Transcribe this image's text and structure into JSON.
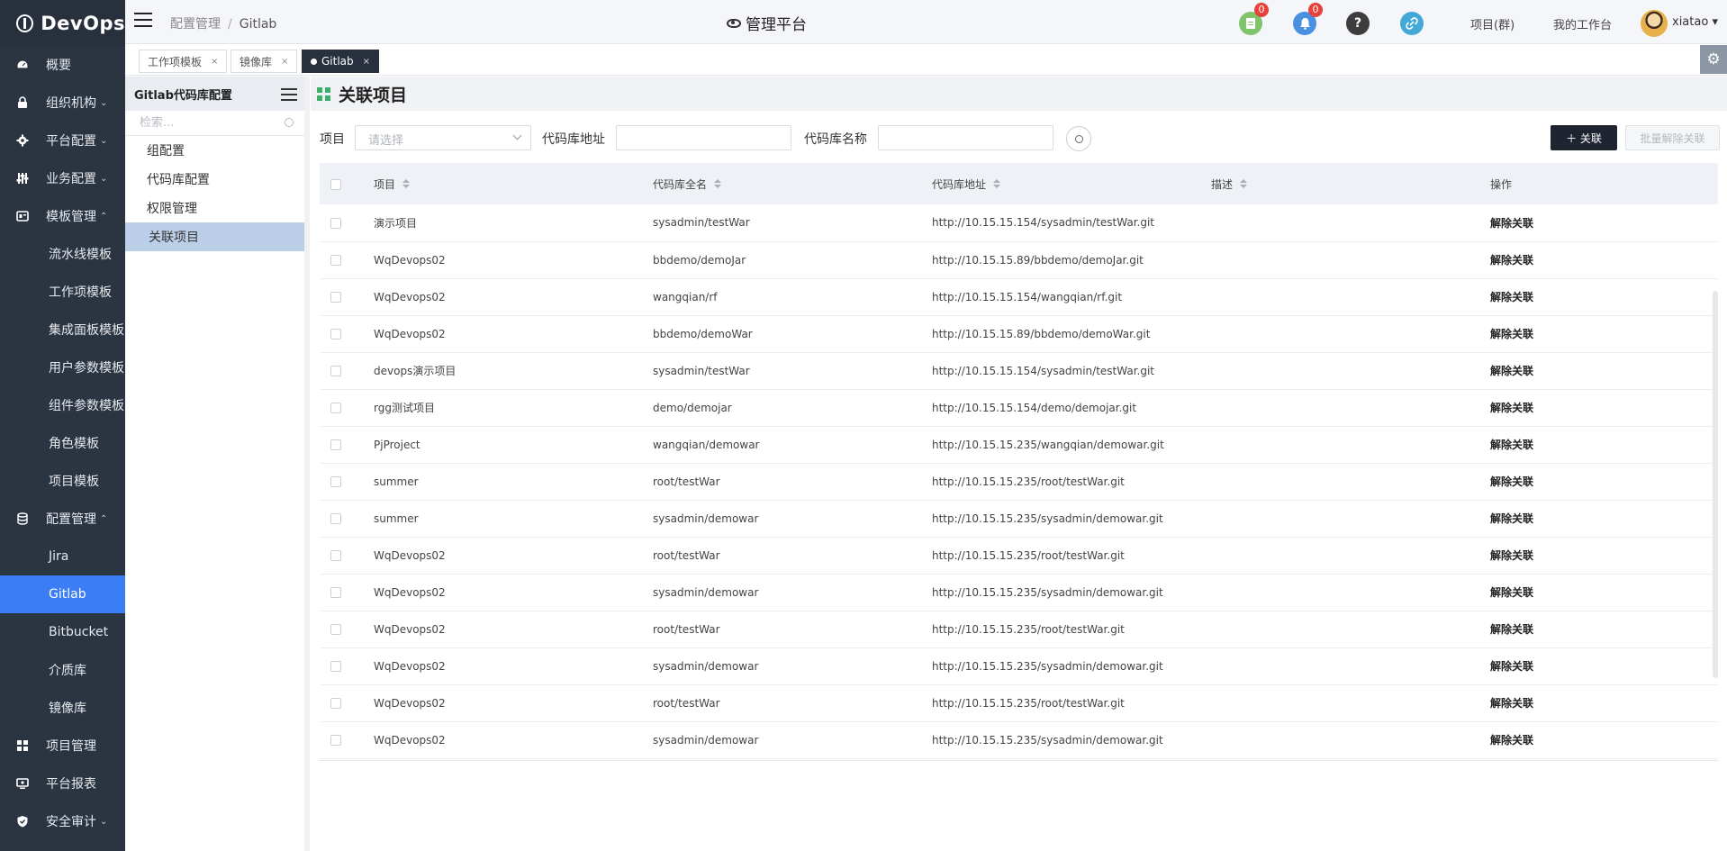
{
  "app": {
    "name": "DevOps"
  },
  "sidebar": {
    "items": [
      {
        "label": "概要",
        "icon": "dashboard-icon",
        "chevron": ""
      },
      {
        "label": "组织机构",
        "icon": "lock-icon",
        "chevron": "⌄"
      },
      {
        "label": "平台配置",
        "icon": "gear-icon",
        "chevron": "⌄"
      },
      {
        "label": "业务配置",
        "icon": "sliders-icon",
        "chevron": "⌄"
      },
      {
        "label": "模板管理",
        "icon": "template-icon",
        "chevron": "⌃"
      }
    ],
    "template_sub": [
      "流水线模板",
      "工作项模板",
      "集成面板模板",
      "用户参数模板",
      "组件参数模板",
      "角色模板",
      "项目模板"
    ],
    "config_item": {
      "label": "配置管理",
      "icon": "database-icon",
      "chevron": "⌃"
    },
    "config_sub": [
      "Jira",
      "Gitlab",
      "Bitbucket",
      "介质库",
      "镜像库"
    ],
    "bottom_items": [
      {
        "label": "项目管理",
        "icon": "grid-icon",
        "chevron": ""
      },
      {
        "label": "平台报表",
        "icon": "report-icon",
        "chevron": ""
      },
      {
        "label": "安全审计",
        "icon": "shield-icon",
        "chevron": "⌄"
      }
    ]
  },
  "header": {
    "breadcrumb": [
      "配置管理",
      "Gitlab"
    ],
    "breadcrumb_sep": "/",
    "platform_title": "管理平台",
    "badge_doc": "0",
    "badge_bell": "0",
    "help_glyph": "?",
    "projects_link": "项目(群)",
    "workbench_link": "我的工作台",
    "username": "xiatao",
    "user_caret": "▾",
    "colors": {
      "doc": "#7fc36b",
      "bell": "#4a90e2",
      "help": "#3d3d3d",
      "link": "#43a8d6"
    }
  },
  "tabs": [
    {
      "label": "工作项模板",
      "close": "×"
    },
    {
      "label": "镜像库",
      "close": "×"
    },
    {
      "label": "Gitlab",
      "close": "×"
    }
  ],
  "left_panel": {
    "title": "Gitlab代码库配置",
    "search_placeholder": "检索...",
    "items": [
      "组配置",
      "代码库配置",
      "权限管理",
      "关联项目"
    ]
  },
  "main": {
    "title": "关联项目",
    "filters": {
      "project_label": "项目",
      "project_placeholder": "请选择",
      "repo_addr_label": "代码库地址",
      "repo_name_label": "代码库名称"
    },
    "link_button": "＋ 关联",
    "batch_unlink_button": "批量解除关联"
  },
  "table": {
    "columns": [
      "项目",
      "代码库全名",
      "代码库地址",
      "描述",
      "操作"
    ],
    "rows": [
      [
        "演示项目",
        "sysadmin/testWar",
        "http://10.15.15.154/sysadmin/testWar.git",
        "",
        "解除关联"
      ],
      [
        "WqDevops02",
        "bbdemo/demoJar",
        "http://10.15.15.89/bbdemo/demoJar.git",
        "",
        "解除关联"
      ],
      [
        "WqDevops02",
        "wangqian/rf",
        "http://10.15.15.154/wangqian/rf.git",
        "",
        "解除关联"
      ],
      [
        "WqDevops02",
        "bbdemo/demoWar",
        "http://10.15.15.89/bbdemo/demoWar.git",
        "",
        "解除关联"
      ],
      [
        "devops演示项目",
        "sysadmin/testWar",
        "http://10.15.15.154/sysadmin/testWar.git",
        "",
        "解除关联"
      ],
      [
        "rgg测试项目",
        "demo/demojar",
        "http://10.15.15.154/demo/demojar.git",
        "",
        "解除关联"
      ],
      [
        "PjProject",
        "wangqian/demowar",
        "http://10.15.15.235/wangqian/demowar.git",
        "",
        "解除关联"
      ],
      [
        "summer",
        "root/testWar",
        "http://10.15.15.235/root/testWar.git",
        "",
        "解除关联"
      ],
      [
        "summer",
        "sysadmin/demowar",
        "http://10.15.15.235/sysadmin/demowar.git",
        "",
        "解除关联"
      ],
      [
        "WqDevops02",
        "root/testWar",
        "http://10.15.15.235/root/testWar.git",
        "",
        "解除关联"
      ],
      [
        "WqDevops02",
        "sysadmin/demowar",
        "http://10.15.15.235/sysadmin/demowar.git",
        "",
        "解除关联"
      ],
      [
        "WqDevops02",
        "root/testWar",
        "http://10.15.15.235/root/testWar.git",
        "",
        "解除关联"
      ],
      [
        "WqDevops02",
        "sysadmin/demowar",
        "http://10.15.15.235/sysadmin/demowar.git",
        "",
        "解除关联"
      ],
      [
        "WqDevops02",
        "root/testWar",
        "http://10.15.15.235/root/testWar.git",
        "",
        "解除关联"
      ],
      [
        "WqDevops02",
        "sysadmin/demowar",
        "http://10.15.15.235/sysadmin/demowar.git",
        "",
        "解除关联"
      ]
    ]
  }
}
